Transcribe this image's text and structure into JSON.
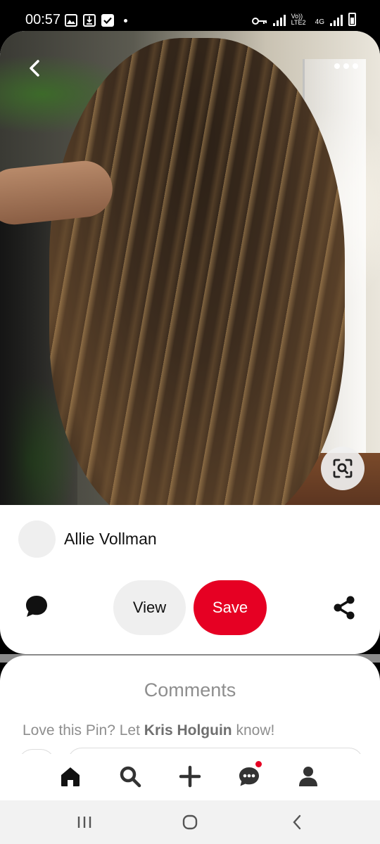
{
  "status_bar": {
    "time": "00:57",
    "left_icons": [
      "image-icon",
      "download-icon",
      "check-icon"
    ],
    "right_icons": [
      "vpn-key-icon",
      "signal-icon",
      "volte-icon",
      "4g-icon",
      "signal-icon",
      "battery-icon"
    ],
    "volte_label": "Vo)) LTE2",
    "network_label": "4G"
  },
  "pin": {
    "image_alt": "Long wavy brunette hair with caramel balayage highlights",
    "author": {
      "name": "Allie Vollman"
    },
    "actions": {
      "view_label": "View",
      "save_label": "Save"
    }
  },
  "comments": {
    "title": "Comments",
    "prompt_prefix": "Love this Pin? Let ",
    "prompt_name": "Kris Holguin",
    "prompt_suffix": " know!"
  },
  "tab_bar": {
    "items": [
      {
        "name": "home",
        "icon": "home-icon",
        "active": true
      },
      {
        "name": "search",
        "icon": "search-icon",
        "active": false
      },
      {
        "name": "create",
        "icon": "plus-icon",
        "active": false
      },
      {
        "name": "messages",
        "icon": "chat-bubble-icon",
        "active": false,
        "has_notification": true
      },
      {
        "name": "profile",
        "icon": "person-icon",
        "active": false
      }
    ]
  },
  "system_nav": {
    "buttons": [
      "recent-apps-icon",
      "home-circle-icon",
      "back-chevron-icon"
    ]
  },
  "colors": {
    "save_red": "#e60023",
    "button_gray": "#efefef",
    "muted_text": "#8e8e8e"
  }
}
